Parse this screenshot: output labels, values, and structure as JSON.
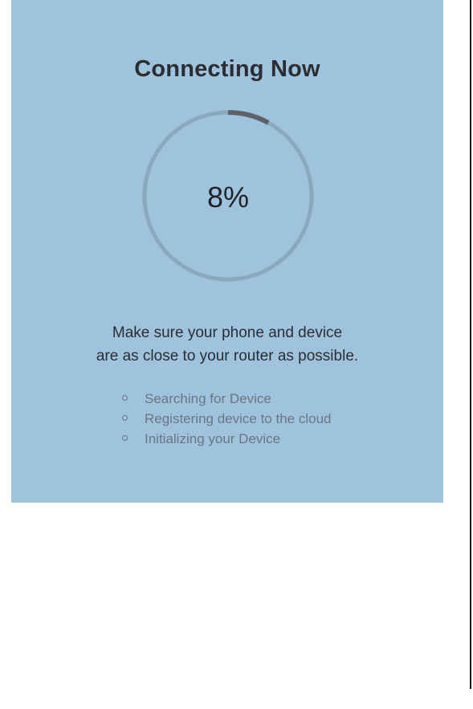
{
  "screen": {
    "title": "Connecting Now",
    "progress": {
      "value": 8,
      "label": "8%"
    },
    "hint_line_1": "Make sure your phone and device",
    "hint_line_2": "are as close to your router as possible.",
    "steps": [
      {
        "label": "Searching for Device"
      },
      {
        "label": "Registering device to the cloud"
      },
      {
        "label": "Initializing your Device"
      }
    ]
  },
  "colors": {
    "panel_background": "#9fc3dd",
    "ring_track": "#8aa9bd",
    "ring_progress": "#5d6268",
    "title_text": "#2a2e33",
    "step_text": "#6a7683"
  }
}
